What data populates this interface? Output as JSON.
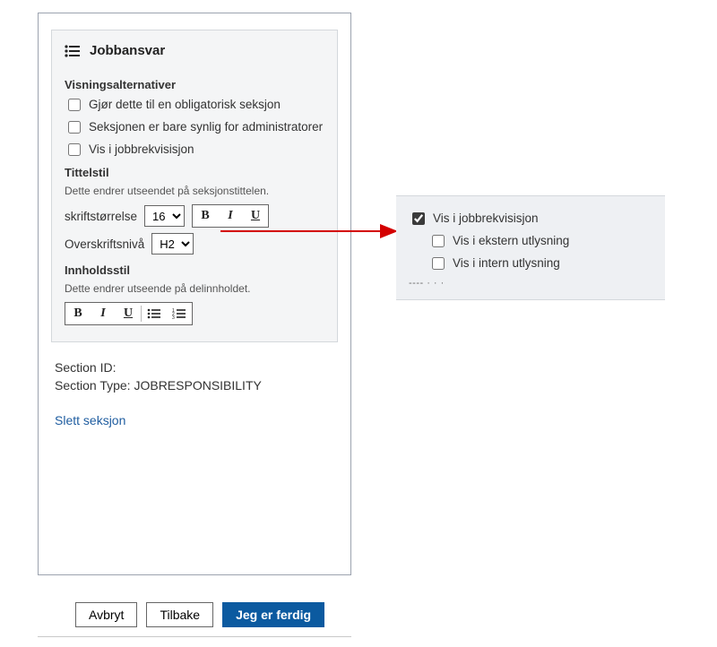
{
  "section": {
    "title": "Jobbansvar",
    "displayOptionsHeading": "Visningsalternativer",
    "options": {
      "mandatory": "Gjør dette til en obligatorisk seksjon",
      "adminOnly": "Seksjonen er bare synlig for administratorer",
      "showInReq": "Vis i jobbrekvisisjon"
    },
    "titleStyle": {
      "heading": "Tittelstil",
      "help": "Dette endrer utseendet på seksjonstittelen.",
      "fontSizeLabel": "skriftstørrelse",
      "fontSizeValue": "16",
      "headingLevelLabel": "Overskriftsnivå",
      "headingLevelValue": "H2"
    },
    "contentStyle": {
      "heading": "Innholdsstil",
      "help": "Dette endrer utseende på delinnholdet."
    },
    "meta": {
      "idLabel": "Section ID:",
      "typeLabel": "Section Type:",
      "typeValue": "JOBRESPONSIBILITY"
    },
    "deleteLabel": "Slett seksjon"
  },
  "buttons": {
    "cancel": "Avbryt",
    "back": "Tilbake",
    "done": "Jeg er ferdig"
  },
  "callout": {
    "showInReq": "Vis i jobbrekvisisjon",
    "external": "Vis i ekstern utlysning",
    "internal": "Vis i intern utlysning",
    "truncated": "---- . . ."
  }
}
